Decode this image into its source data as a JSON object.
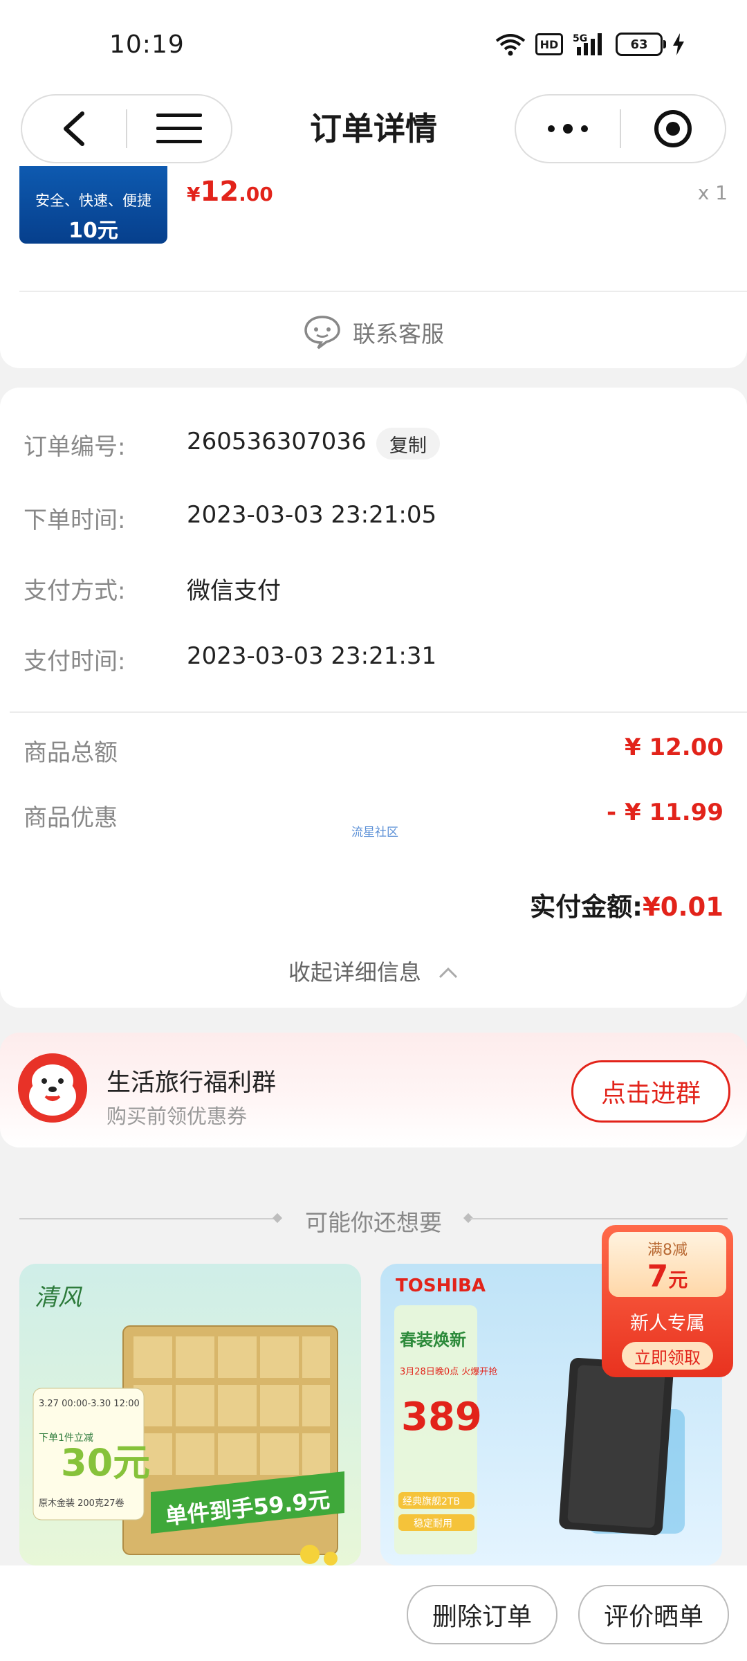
{
  "status_bar": {
    "time": "10:19",
    "network": "5G",
    "hd": "HD",
    "battery": "63"
  },
  "nav": {
    "title": "订单详情"
  },
  "product": {
    "thumb_line1": "安全、快速、便捷",
    "thumb_line2": "10元",
    "price_symbol": "¥",
    "price_int": "12",
    "price_dec": ".00",
    "quantity": "x 1"
  },
  "service": {
    "label": "联系客服"
  },
  "order_info": [
    {
      "label": "订单编号:",
      "value": "260536307036"
    },
    {
      "label": "下单时间:",
      "value": "2023-03-03 23:21:05"
    },
    {
      "label": "支付方式:",
      "value": "微信支付"
    },
    {
      "label": "支付时间:",
      "value": "2023-03-03 23:21:31"
    }
  ],
  "copy_label": "复制",
  "amounts": {
    "total_label": "商品总额",
    "total_value": "¥ 12.00",
    "discount_label": "商品优惠",
    "discount_value": "- ¥ 11.99",
    "paid_label": "实付金额:",
    "paid_value": "¥0.01"
  },
  "watermark": "流星社区",
  "collapse_label": "收起详细信息",
  "group": {
    "title": "生活旅行福利群",
    "subtitle": "购买前领优惠券",
    "button": "点击进群"
  },
  "recommend": {
    "title": "可能你还想要"
  },
  "coupon": {
    "condition": "满8减",
    "amount": "7",
    "unit": "元",
    "tag": "新人专属",
    "button": "立即领取"
  },
  "products": [
    {
      "brand": "清风",
      "headline": "单件到手59.9元",
      "badge": "30元",
      "badge_prefix": "下单1件立减",
      "date": "3.27 00:00-3.30 12:00",
      "line1": "原木金装 200克27卷"
    },
    {
      "brand": "TOSHIBA",
      "headline": "春装焕新",
      "sub": "3月28日晚0点 火爆开抢",
      "price": "389",
      "line1": "经典旗舰2TB",
      "line2": "稳定耐用"
    }
  ],
  "bottom": {
    "delete_label": "删除订单",
    "review_label": "评价晒单"
  },
  "colors": {
    "accent": "#e2231a",
    "background": "#f2f2f2"
  }
}
